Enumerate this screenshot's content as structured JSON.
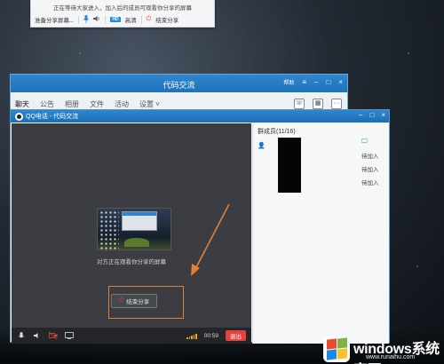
{
  "sharebar": {
    "message": "正在等待大家进入，加入后的成员可观看你分享的屏幕",
    "prep_label": "准备分享屏幕...",
    "hd_badge": "HD",
    "quality_label": "高清",
    "end_label": "结束分享"
  },
  "group_window": {
    "title": "代码交流",
    "help_label": "帮助",
    "tabs": [
      "聊天",
      "公告",
      "相册",
      "文件",
      "活动",
      "设置 ˅"
    ]
  },
  "call_window": {
    "title": "QQ电话 - 代码交流",
    "watching_text": "对方正在观看你分享的屏幕",
    "end_share_label": "结束分享",
    "timer": "00:59",
    "exit_label": "退出",
    "members_header": "群成员(11/16)",
    "member_status": [
      "待加入",
      "待加入",
      "待加入"
    ]
  },
  "watermark": {
    "brand_main": "windows",
    "brand_rest": "系统家园",
    "sub": "www.runaihu.com"
  },
  "colors": {
    "title_blue": "#1f73bb",
    "annotation_orange": "#e4802f",
    "end_red": "#e0443c"
  }
}
